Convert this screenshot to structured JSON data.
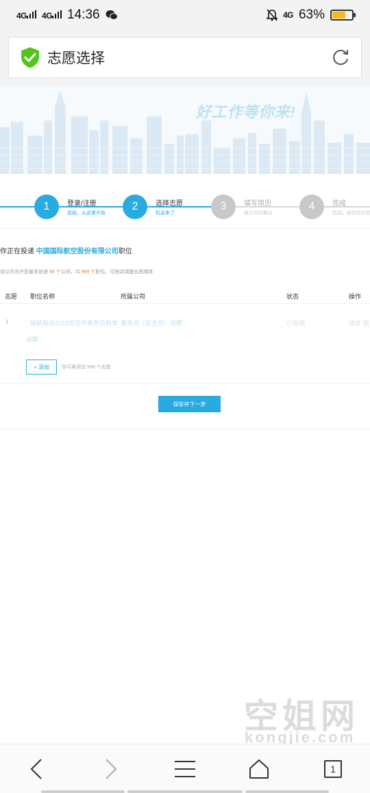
{
  "status_bar": {
    "signal1": "4G",
    "signal2": "4G",
    "time": "14:36",
    "network_right": "4G",
    "battery": "63%",
    "battery_level": 0.63
  },
  "browser": {
    "page_title": "志愿选择",
    "tab_count": "1"
  },
  "banner": {
    "slogan": "好工作等你来!"
  },
  "steps": [
    {
      "number": "1",
      "title": "登录/注册",
      "subtitle": "启程，从这里开始",
      "state": "active"
    },
    {
      "number": "2",
      "title": "选择志愿",
      "subtitle": "机会来了",
      "state": "active"
    },
    {
      "number": "3",
      "title": "填写简历",
      "subtitle": "展示你的舞台",
      "state": "inactive"
    },
    {
      "number": "4",
      "title": "完成",
      "subtitle": "加油，期待你的到来",
      "state": "inactive"
    }
  ],
  "apply": {
    "prefix": "你正在投递 ",
    "company": "中国国际航空股份有限公司",
    "suffix": "职位"
  },
  "hint": {
    "part1": "该公司允许您最多投递 ",
    "max_companies": "99",
    "part2": " 个公司，共 ",
    "max_positions": "999",
    "part3": " 个职位。可拖动调整志愿顺序"
  },
  "table": {
    "headers": [
      "志愿",
      "职位名称",
      "所属公司",
      "状态",
      "操作"
    ],
    "rows": [
      {
        "no": "1",
        "position_line1": "国航股份2018年空中乘务员秋季",
        "position_line2": "招聘",
        "company": "乘务员（安全员）招聘",
        "status": "已处理",
        "ops": "修改  删"
      }
    ]
  },
  "add": {
    "button": "+ 添加",
    "hint": "你可再添加 998 个志愿"
  },
  "save_button": "保存并下一步",
  "watermark": {
    "cn": "空姐网",
    "en": "kongjie.com"
  },
  "colors": {
    "accent": "#29abe2",
    "inactive": "#c8c8c8",
    "highlight_number": "#f08030",
    "shield": "#52c41a"
  }
}
